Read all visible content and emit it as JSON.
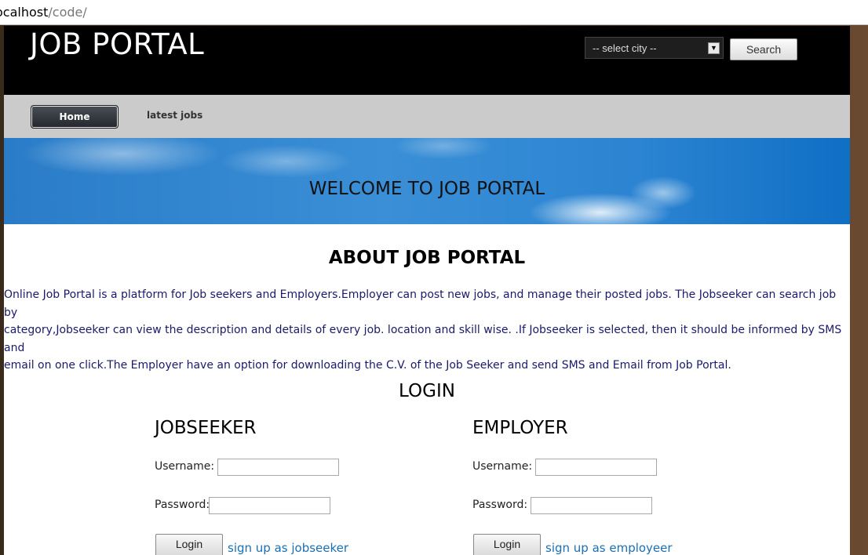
{
  "browser": {
    "url_host": "ocalhost",
    "url_path": "/code/"
  },
  "header": {
    "logo": "JOB PORTAL",
    "city_select": {
      "selected": "-- select city --"
    },
    "search_label": "Search"
  },
  "nav": {
    "items": [
      {
        "label": "Home",
        "active": true
      },
      {
        "label": "latest jobs",
        "active": false
      }
    ]
  },
  "banner": {
    "title": "WELCOME TO JOB PORTAL"
  },
  "about": {
    "title": "ABOUT JOB PORTAL",
    "lines": [
      "Online Job Portal is a platform for Job seekers and Employers.Employer can post new jobs, and manage their posted jobs. The Jobseeker can search job by",
      "category,Jobseeker can view the description and details of every job. location and skill wise. .If Jobseeker is selected, then it should be informed by SMS and",
      "email on one click.The Employer have an option for downloading the C.V. of the Job Seeker and send SMS and Email from Job Portal."
    ]
  },
  "login": {
    "title": "LOGIN",
    "jobseeker": {
      "heading": "JOBSEEKER",
      "username_label": "Username:",
      "password_label": "Password:",
      "username_value": "",
      "password_value": "",
      "login_label": "Login",
      "signup_link": "sign up as jobseeker"
    },
    "employer": {
      "heading": "EMPLOYER",
      "username_label": "Username:",
      "password_label": "Password:",
      "username_value": "",
      "password_value": "",
      "login_label": "Login",
      "signup_link": "sign up as employeer"
    }
  },
  "colors": {
    "header_bg": "#000000",
    "nav_bg": "#cbcbcb",
    "banner_blue": "#2c84d2",
    "link": "#1a6fb5",
    "about_text": "#1a1a6a"
  }
}
